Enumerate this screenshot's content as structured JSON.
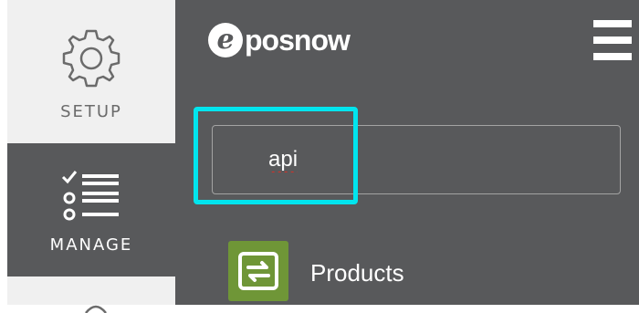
{
  "app": {
    "logo_letter": "e",
    "logo_text": "posnow",
    "brand_color": "#58595b",
    "highlight_color": "#00e5ee"
  },
  "sidebar": {
    "items": [
      {
        "label": "SETUP",
        "icon": "gear-icon"
      },
      {
        "label": "MANAGE",
        "icon": "checklist-icon"
      },
      {
        "label": "",
        "icon": "partial-icon"
      }
    ]
  },
  "header": {
    "menu_icon": "hamburger-menu-icon"
  },
  "search": {
    "value": "api"
  },
  "results": [
    {
      "label": "Products",
      "icon": "products-icon",
      "icon_color": "#6f9637"
    }
  ]
}
